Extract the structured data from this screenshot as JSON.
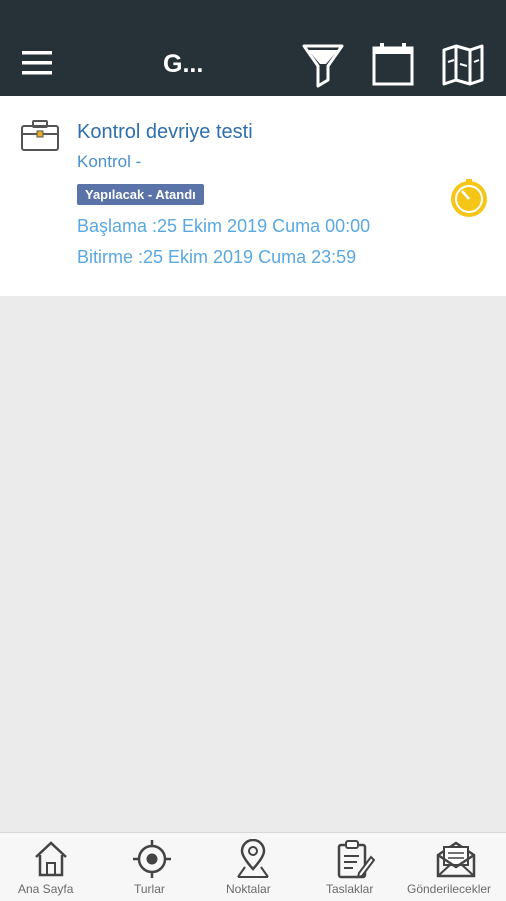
{
  "header": {
    "title": "G...",
    "icons": [
      "menu-icon",
      "filter-icon",
      "calendar-icon",
      "map-icon"
    ]
  },
  "task": {
    "title": "Kontrol devriye testi",
    "subtitle": "Kontrol -",
    "status": "Yapılacak - Atandı",
    "start": "Başlama :25 Ekim 2019 Cuma 00:00",
    "end": "Bitirme :25 Ekim 2019 Cuma 23:59",
    "icons": [
      "briefcase-icon",
      "timer-icon"
    ]
  },
  "nav": {
    "items": [
      {
        "label": "Ana Sayfa",
        "icon": "home-icon"
      },
      {
        "label": "Turlar",
        "icon": "target-icon"
      },
      {
        "label": "Noktalar",
        "icon": "map-pin-icon"
      },
      {
        "label": "Taslaklar",
        "icon": "clipboard-icon"
      },
      {
        "label": "Gönderilecekler",
        "icon": "envelope-icon"
      }
    ]
  },
  "colors": {
    "header_bg": "#263238",
    "title_blue": "#2f6fad",
    "date_blue": "#59a8e0",
    "badge_bg": "#5a73a8",
    "timer_yellow": "#f5c518",
    "background": "#ebebeb"
  }
}
